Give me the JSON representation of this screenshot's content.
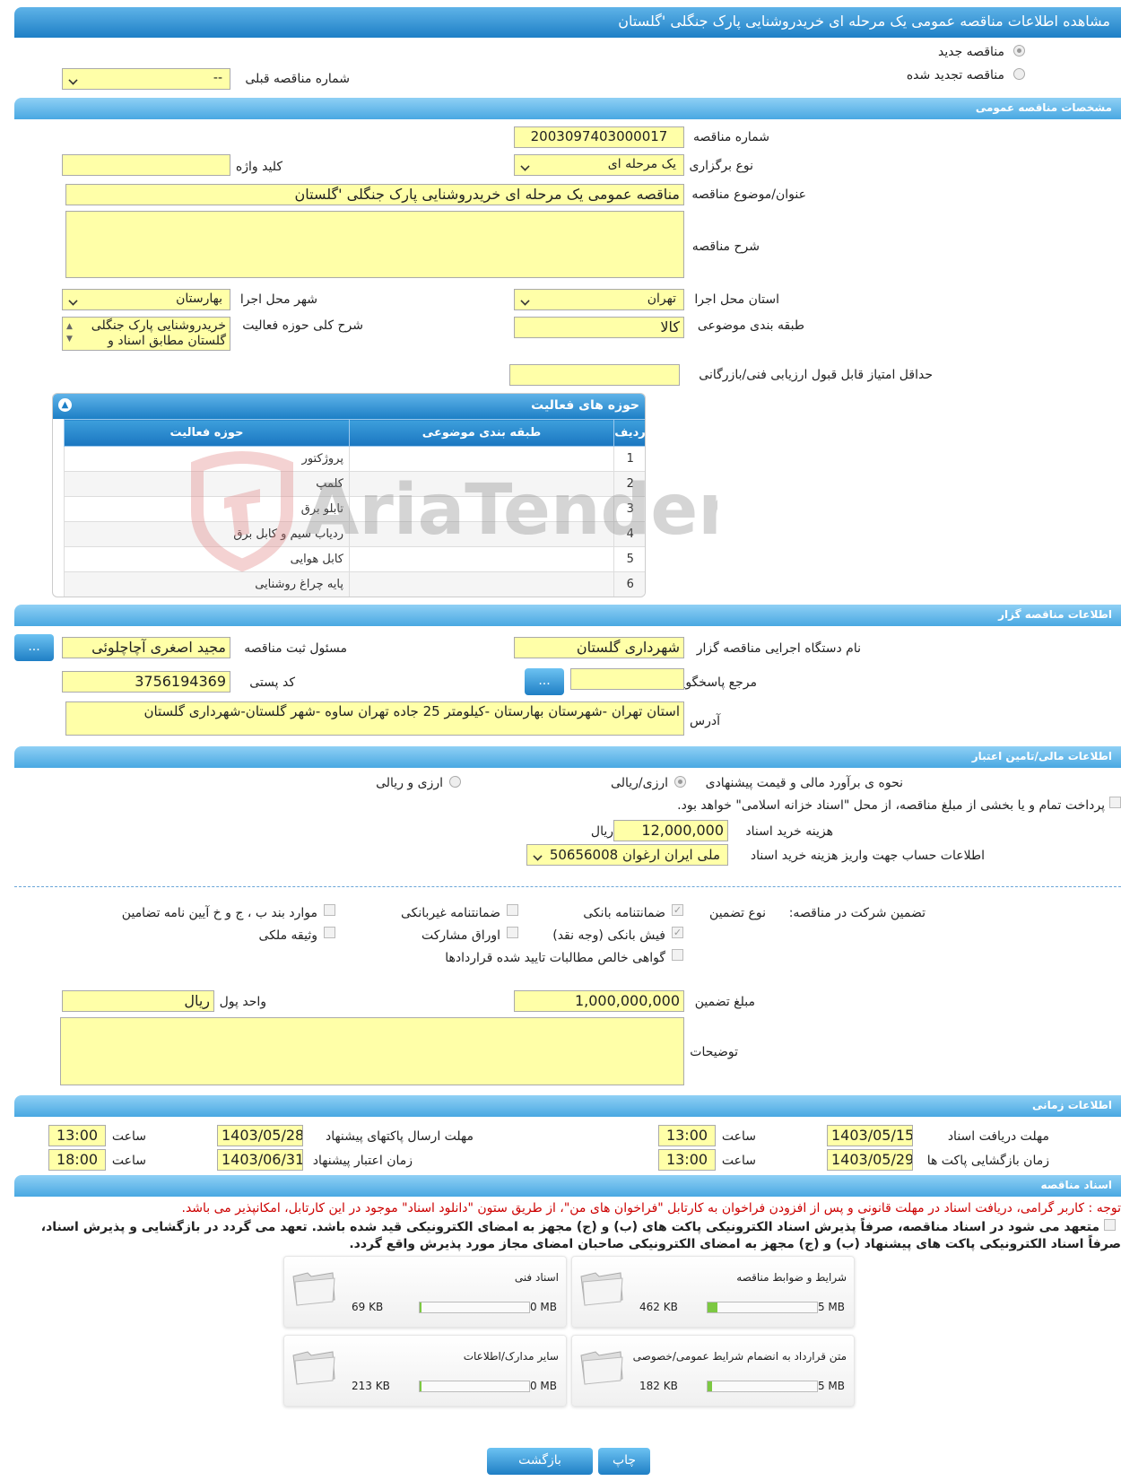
{
  "title": "مشاهده اطلاعات مناقصه عمومی یک مرحله ای خریدروشنایی پارک جنگلی 'گلستان",
  "type_new": "مناقصه جدید",
  "type_renewed": "مناقصه تجدید شده",
  "prev_number_label": "شماره مناقصه قبلی",
  "prev_number_value": "--",
  "s1": {
    "header": "مشخصات مناقصه عمومی",
    "number_label": "شماره مناقصه",
    "number": "2003097403000017",
    "hold_label": "نوع برگزاری",
    "hold": "یک مرحله ای",
    "keyword_label": "کلید واژه",
    "keyword": "",
    "subject_label": "عنوان/موضوع مناقصه",
    "subject": "مناقصه عمومی یک مرحله ای خریدروشنایی پارک جنگلی 'گلستان",
    "desc_label": "شرح مناقصه",
    "desc": "",
    "province_label": "استان محل اجرا",
    "province": "تهران",
    "city_label": "شهر محل اجرا",
    "city": "بهارستان",
    "category_label": "طبقه بندی موضوعی",
    "category": "کالا",
    "scope_label": "شرح کلی حوزه فعالیت",
    "scope": "خریدروشنایی پارک جنگلی گلستان مطابق اسناد و",
    "min_score_label": "حداقل امتیاز قابل قبول ارزیابی فنی/بازرگانی",
    "min_score": ""
  },
  "activity": {
    "header": "حوزه های فعالیت",
    "col_row": "ردیف",
    "col_cat": "طبقه بندی موضوعی",
    "col_scope": "حوزه فعالیت",
    "rows": [
      {
        "n": "1",
        "c": "",
        "s": "پروژکتور"
      },
      {
        "n": "2",
        "c": "",
        "s": "کلمپ"
      },
      {
        "n": "3",
        "c": "",
        "s": "تابلو برق"
      },
      {
        "n": "4",
        "c": "",
        "s": "ردیاب سیم و کابل برق"
      },
      {
        "n": "5",
        "c": "",
        "s": "کابل هوایی"
      },
      {
        "n": "6",
        "c": "",
        "s": "پایه چراغ روشنایی"
      }
    ]
  },
  "s2": {
    "header": "اطلاعات مناقصه گزار",
    "org_label": "نام دستگاه اجرایی مناقصه گزار",
    "org": "شهرداری گلستان",
    "resp_label": "مسئول ثبت مناقصه",
    "resp": "مجید اصغری آچاچلوئی",
    "ref_label": "مرجع پاسخگویی",
    "ref": "",
    "postal_label": "کد پستی",
    "postal": "3756194369",
    "address_label": "آدرس",
    "address": "استان تهران -شهرستان بهارستان -کیلومتر 25 جاده تهران ساوه -شهر گلستان-شهرداری گلستان",
    "dots": "..."
  },
  "s3": {
    "header": "اطلاعات مالی/تامین اعتبار",
    "estimate_label": "نحوه ی برآورد مالی و قیمت پیشنهادی",
    "opt1": "ارزی/ریالی",
    "opt2": "ارزی و ریالی",
    "treasury": "پرداخت تمام و یا بخشی از مبلغ مناقصه، از محل \"اسناد خزانه اسلامی\" خواهد بود.",
    "doc_fee_label": "هزینه خرید اسناد",
    "doc_fee": "12,000,000",
    "rial": "ریال",
    "account_label": "اطلاعات حساب جهت واریز هزینه خرید اسناد",
    "account": "ملی ایران ارغوان 50656008",
    "guarantee_label": "تضمین شرکت در مناقصه:",
    "guarantee_type_label": "نوع تضمین",
    "g1": "ضمانتنامه بانکی",
    "g2": "ضمانتنامه غیربانکی",
    "g3": "موارد بند ب ، ج و خ آیین نامه تضامین",
    "g4": "فیش بانکی (وجه نقد)",
    "g5": "اوراق مشارکت",
    "g6": "وثیقه ملکی",
    "g7": "گواهی خالص مطالبات تایید شده قراردادها",
    "amount_label": "مبلغ تضمین",
    "amount": "1,000,000,000",
    "currency_label": "واحد پول",
    "currency": "ریال",
    "notes_label": "توضیحات",
    "notes": "",
    "check": "✓"
  },
  "s4": {
    "header": "اطلاعات زمانی",
    "receive_label": "مهلت دریافت اسناد",
    "receive_date": "1403/05/15",
    "receive_time": "13:00",
    "send_label": "مهلت ارسال پاکتهای پیشنهاد",
    "send_date": "1403/05/28",
    "send_time": "13:00",
    "open_label": "زمان بازگشایی پاکت ها",
    "open_date": "1403/05/29",
    "open_time": "13:00",
    "valid_label": "زمان اعتبار پیشنهاد",
    "valid_date": "1403/06/31",
    "valid_time": "18:00",
    "time_label": "ساعت"
  },
  "s5": {
    "header": "اسناد مناقصه",
    "notice": "توجه : کاربر گرامی، دریافت اسناد در مهلت قانونی و پس از افزودن فراخوان به کارتابل \"فراخوان های من\"، از طریق ستون \"دانلود اسناد\" موجود در این کارتابل، امکانپذیر می باشد.",
    "commit1": "متعهد می شود در اسناد مناقصه، صرفاً پذیرش اسناد الکترونیکی پاکت های (ب) و (ج) مجهز به امضای الکترونیکی قید شده باشد. تعهد می گردد در بازگشایی و پذیرش اسناد،",
    "commit2": "صرفاً اسناد الکترونیکی پاکت های پیشنهاد (ب) و (ج) مجهز به امضای الکترونیکی صاحبان امضای مجاز مورد پذیرش واقع گردد.",
    "files": [
      {
        "name": "شرایط و ضوابط مناقصه",
        "size": "462 KB",
        "max": "5 MB",
        "fill": 0.09
      },
      {
        "name": "اسناد فنی",
        "size": "69 KB",
        "max": "50 MB",
        "fill": 0.01
      },
      {
        "name": "متن قرارداد به انضمام شرایط عمومی/خصوصی",
        "size": "182 KB",
        "max": "5 MB",
        "fill": 0.04
      },
      {
        "name": "سایر مدارک/اطلاعات",
        "size": "213 KB",
        "max": "50 MB",
        "fill": 0.01
      }
    ]
  },
  "buttons": {
    "print": "چاپ",
    "back": "بازگشت"
  },
  "colors": {
    "header": "#1d7fc6",
    "section": "#49a8e2",
    "field": "#ffffa8",
    "progress": "#7cc842",
    "notice": "#cc0000"
  }
}
